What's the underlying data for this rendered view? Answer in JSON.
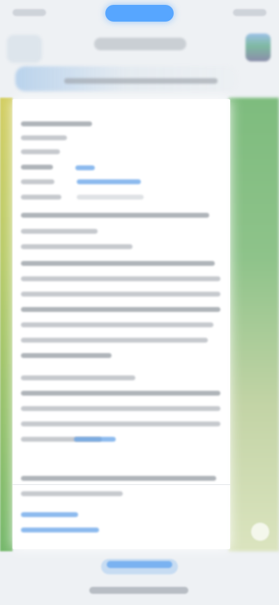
{
  "app": {
    "status_center_label": "",
    "title": ""
  },
  "content": {
    "rows": []
  }
}
